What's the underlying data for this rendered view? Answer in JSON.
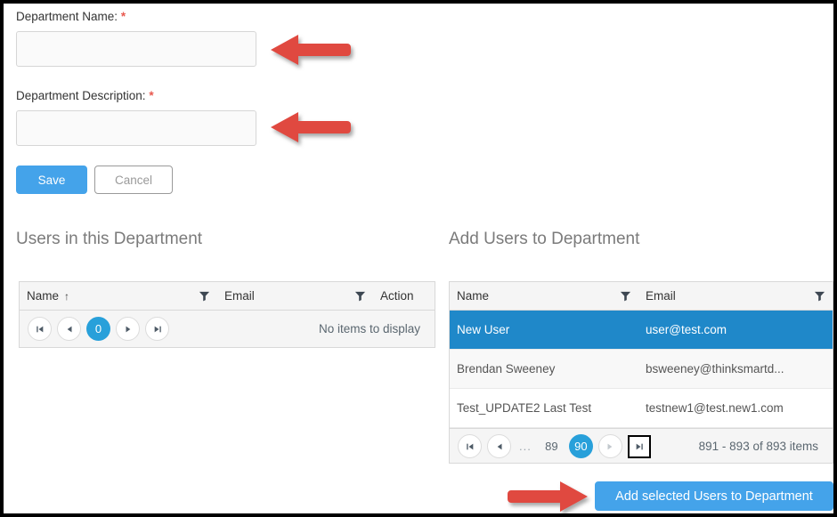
{
  "form": {
    "name_label": "Department Name:",
    "name_required_mark": "*",
    "name_value": "",
    "name_placeholder": "",
    "description_label": "Department Description:",
    "description_required_mark": "*",
    "description_value": "",
    "description_placeholder": "",
    "save_label": "Save",
    "cancel_label": "Cancel"
  },
  "left_panel": {
    "heading": "Users in this Department",
    "columns": [
      "Name",
      "Email",
      "Action"
    ],
    "sort_indicator": "↑",
    "sorted_column": "Name",
    "rows": [],
    "empty_message": "No items to display",
    "pager": {
      "first_icon": "first-page-icon",
      "prev_icon": "previous-page-icon",
      "next_icon": "next-page-icon",
      "last_icon": "last-page-icon",
      "pages": [
        "0"
      ],
      "current_page": "0"
    }
  },
  "right_panel": {
    "heading": "Add Users to Department",
    "columns": [
      "Name",
      "Email"
    ],
    "rows": [
      {
        "name": "New User",
        "email": "user@test.com",
        "selected": true
      },
      {
        "name": "Brendan Sweeney",
        "email": "bsweeney@thinksmartd...",
        "selected": false
      },
      {
        "name": "Test_UPDATE2 Last Test",
        "email": "testnew1@test.new1.com",
        "selected": false
      }
    ],
    "pager": {
      "first_icon": "first-page-icon",
      "prev_icon": "previous-page-icon",
      "next_icon": "next-page-icon",
      "last_icon": "last-page-icon",
      "ellipsis": "...",
      "pages": [
        "89",
        "90"
      ],
      "current_page": "90",
      "info": "891 - 893 of 893 items"
    },
    "add_button_label": "Add selected Users to Department"
  },
  "annotations": {
    "arrow_name_field": "red-arrow-pointing-to-name-field",
    "arrow_description_field": "red-arrow-pointing-to-description-field",
    "arrow_add_button": "red-arrow-pointing-to-add-button"
  },
  "colors": {
    "accent_blue": "#44a3ea",
    "selected_row_blue": "#1f88c9",
    "pager_active_blue": "#28a0da",
    "required_red": "#e8594f",
    "arrow_red": "#e0483f",
    "heading_gray": "#7b7b7b"
  }
}
